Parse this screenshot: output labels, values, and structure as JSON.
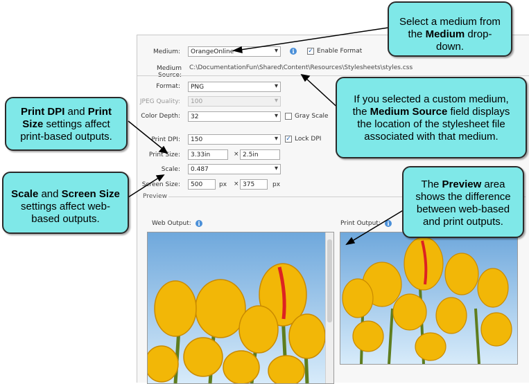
{
  "form": {
    "medium_label": "Medium:",
    "medium_value": "OrangeOnline",
    "enable_format_label": "Enable Format",
    "medium_source_label": "Medium Source:",
    "medium_source_value": "C:\\DocumentationFun\\Shared\\Content\\Resources\\Stylesheets\\styles.css",
    "format_label": "Format:",
    "format_value": "PNG",
    "jpeg_quality_label": "JPEG Quality:",
    "jpeg_quality_value": "100",
    "color_depth_label": "Color Depth:",
    "color_depth_value": "32",
    "gray_scale_label": "Gray Scale",
    "print_dpi_label": "Print DPI:",
    "print_dpi_value": "150",
    "lock_dpi_label": "Lock DPI",
    "print_size_label": "Print Size:",
    "print_width": "3.33in",
    "print_height": "2.5in",
    "times": "×",
    "scale_label": "Scale:",
    "scale_value": "0.487",
    "screen_size_label": "Screen Size:",
    "screen_width": "500",
    "screen_height": "375",
    "px": "px",
    "preview_label": "Preview",
    "web_output_label": "Web Output:",
    "print_output_label": "Print Output:"
  },
  "callouts": {
    "medium": {
      "pre": "Select a medium from the ",
      "bold": "Medium",
      "post": " drop-down."
    },
    "source": {
      "pre": "If you selected a custom medium, the ",
      "bold": "Medium Source",
      "post": " field displays the location of the stylesheet file associated with that medium."
    },
    "print": {
      "bold1": "Print DPI",
      "mid": " and ",
      "bold2": "Print Size",
      "post": " settings affect print-based outputs."
    },
    "scale": {
      "bold1": "Scale",
      "mid": " and ",
      "bold2": "Screen Size",
      "post": " settings affect web-based outputs."
    },
    "preview": {
      "pre": "The ",
      "bold": "Preview",
      "post": " area shows the difference between web-based and print outputs."
    }
  },
  "colors": {
    "callout_fill": "#7fe8e8",
    "info_icon": "#4a8fd8",
    "sky": "#cfe3f5",
    "tulip": "#f2b707"
  },
  "icons": [
    "info-icon",
    "checkbox-checked-icon",
    "checkbox-empty-icon",
    "dropdown-arrow-icon",
    "tulip-image"
  ]
}
